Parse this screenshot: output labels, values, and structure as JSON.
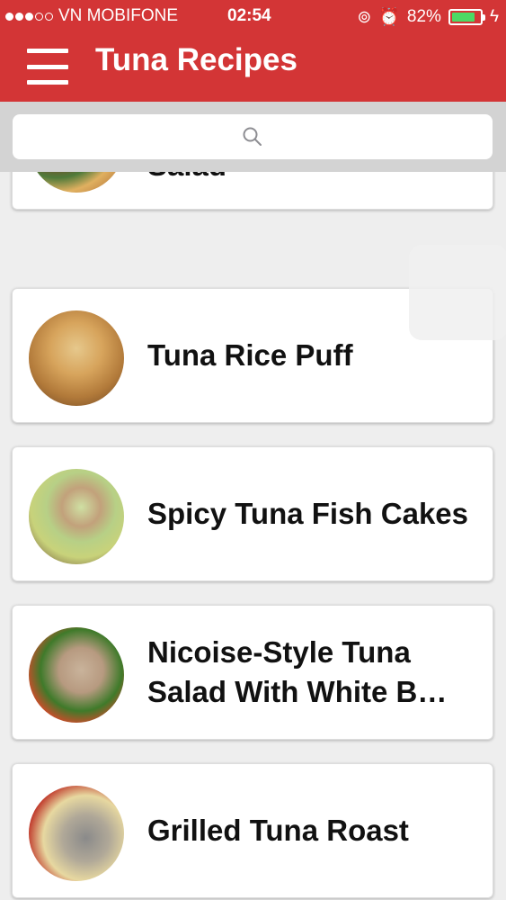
{
  "status_bar": {
    "carrier": "VN MOBIFONE",
    "time": "02:54",
    "battery_percent": "82%",
    "battery_level": 0.82
  },
  "nav": {
    "title": "Tuna Recipes"
  },
  "search": {
    "placeholder": ""
  },
  "recipes": [
    {
      "title": "Tuna  and Mandarin Salad"
    },
    {
      "title": "Tuna Rice Puff"
    },
    {
      "title": "Spicy Tuna Fish Cakes"
    },
    {
      "title": "Nicoise-Style Tuna Salad With White B…"
    },
    {
      "title": "Grilled Tuna Roast"
    }
  ]
}
